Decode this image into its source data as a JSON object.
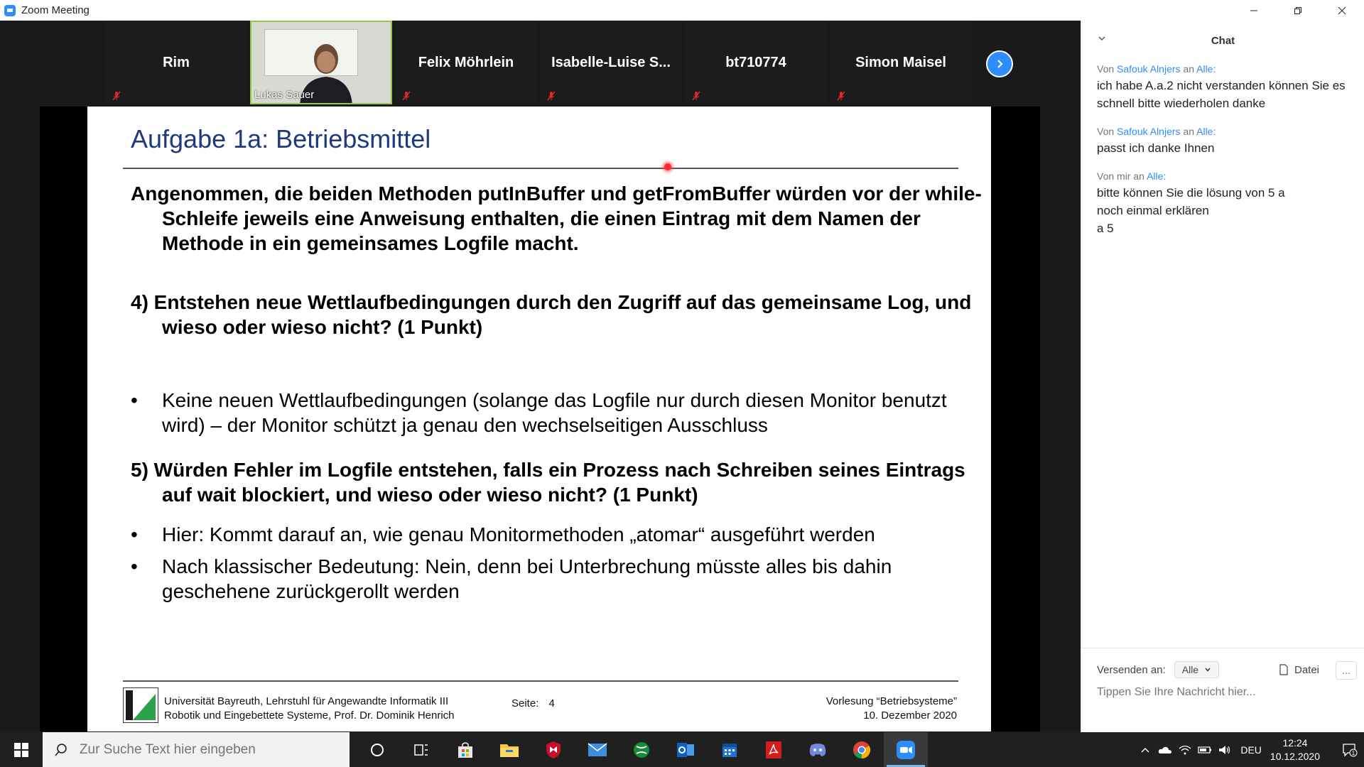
{
  "window": {
    "title": "Zoom Meeting"
  },
  "gallery": {
    "participants": [
      {
        "name": "Rim",
        "video": false
      },
      {
        "name": "Lukas Sauer",
        "video": true
      },
      {
        "name": "Felix Möhrlein",
        "video": false
      },
      {
        "name": "Isabelle-Luise  S...",
        "video": false
      },
      {
        "name": "bt710774",
        "video": false
      },
      {
        "name": "Simon Maisel",
        "video": false
      }
    ]
  },
  "slide": {
    "title": "Aufgabe 1a: Betriebsmittel",
    "intro": "Angenommen, die beiden Methoden putInBuffer und getFromBuffer würden vor der while-Schleife jeweils eine Anweisung enthalten, die einen Eintrag mit dem Namen der Methode in ein gemeinsames Logfile macht.",
    "q4": "4) Entstehen neue Wettlaufbedingungen durch den Zugriff auf das gemeinsame Log, und wieso oder wieso nicht? (1 Punkt)",
    "a4": "Keine neuen Wettlaufbedingungen (solange das Logfile nur durch diesen Monitor benutzt wird) – der Monitor schützt ja genau den wechselseitigen Ausschluss",
    "q5": "5) Würden Fehler im Logfile entstehen, falls ein Prozess nach Schreiben seines Eintrags auf wait blockiert, und wieso oder wieso nicht? (1 Punkt)",
    "a5_1": "Hier: Kommt darauf an, wie genau Monitormethoden „atomar“ ausgeführt werden",
    "a5_2": "Nach klassischer Bedeutung: Nein, denn bei Unterbrechung müsste alles bis dahin geschehene zurückgerollt werden",
    "bullet": "•",
    "footer": {
      "uni_line1": "Universität Bayreuth, Lehrstuhl für Angewandte Informatik III",
      "uni_line2": "Robotik und Eingebettete Systeme, Prof. Dr. Dominik Henrich",
      "page_label": "Seite:",
      "page_number": "4",
      "course": "Vorlesung “Betriebsysteme”",
      "date": "10. Dezember 2020"
    }
  },
  "chat": {
    "title": "Chat",
    "messages": [
      {
        "from_label": "Von",
        "sender": "Safouk Alnjers",
        "to_label": "an",
        "recipient": "Alle:",
        "text": "ich habe A.a.2 nicht verstanden  können Sie es schnell  bitte wiederholen   danke"
      },
      {
        "from_label": "Von",
        "sender": "Safouk Alnjers",
        "to_label": "an",
        "recipient": "Alle:",
        "text": " passt  ich danke Ihnen"
      },
      {
        "from_label": "Von mir",
        "sender": "",
        "to_label": "an",
        "recipient": "Alle:",
        "text": "bitte können Sie die lösung von 5 a\nnoch einmal erklären\na 5"
      }
    ],
    "send_to_label": "Versenden an:",
    "send_to_value": "Alle",
    "file_label": "Datei",
    "more_label": "...",
    "input_placeholder": "Tippen Sie Ihre Nachricht hier..."
  },
  "taskbar": {
    "search_placeholder": "Zur Suche Text hier eingeben",
    "apps": [
      "task-view",
      "microsoft-store",
      "file-explorer",
      "mcafee",
      "mail",
      "xbox",
      "outlook",
      "calendar",
      "acrobat",
      "discord",
      "chrome",
      "zoom"
    ],
    "language": "DEU",
    "time": "12:24",
    "date": "10.12.2020",
    "notification_count": "1"
  },
  "colors": {
    "zoom_blue": "#2D8CFF",
    "slide_title": "#1f3a7a",
    "active_speaker": "#9bc646",
    "mute_red": "#e02828"
  }
}
